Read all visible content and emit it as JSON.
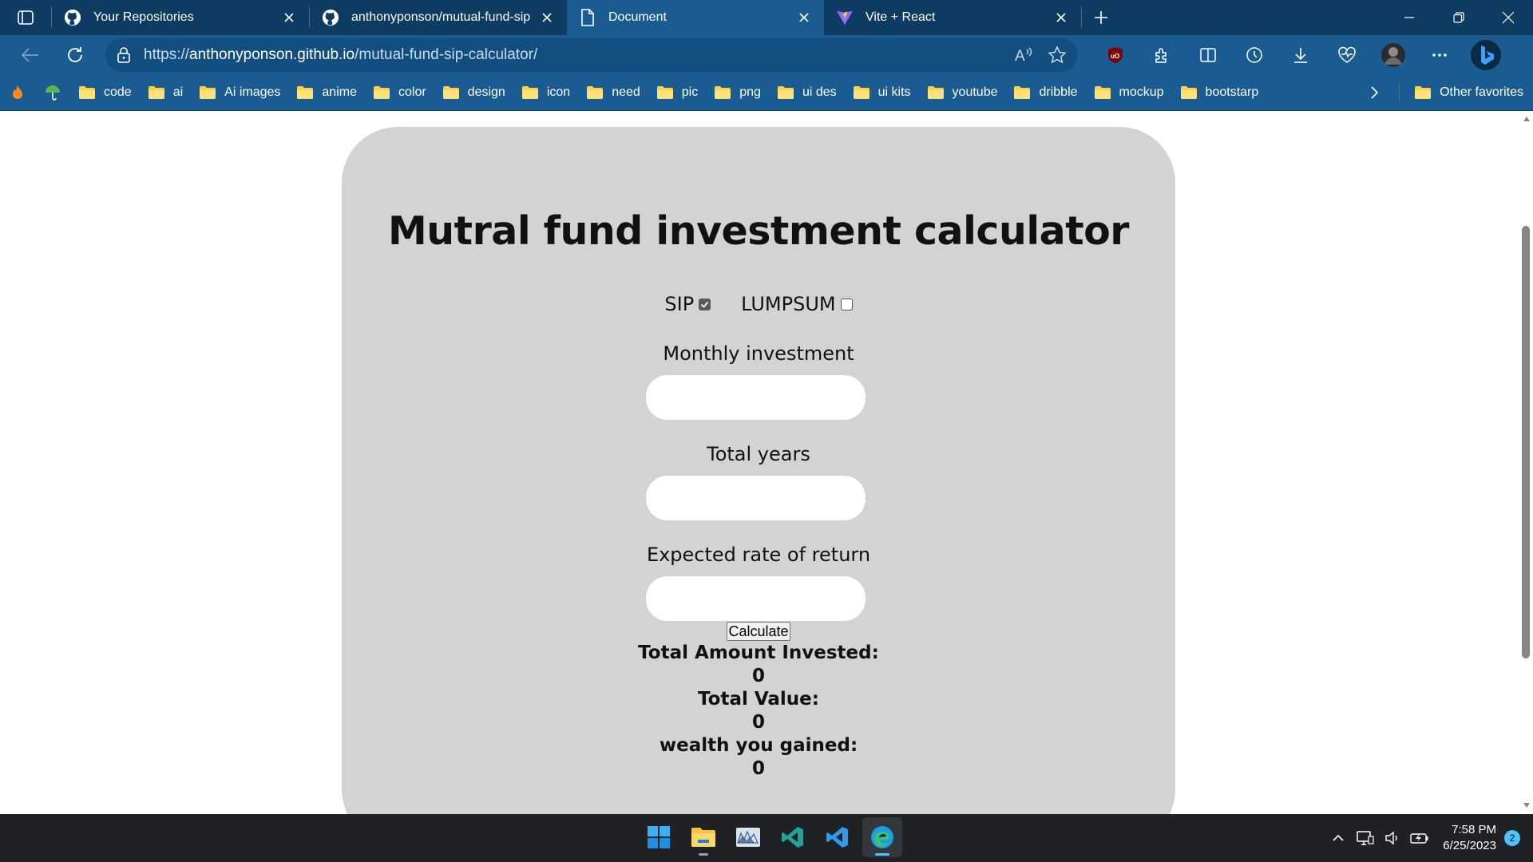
{
  "browser": {
    "tabs": [
      {
        "title": "Your Repositories",
        "icon": "github-icon"
      },
      {
        "title": "anthonyponson/mutual-fund-sip",
        "icon": "github-icon"
      },
      {
        "title": "Document",
        "icon": "document-icon"
      },
      {
        "title": "Vite + React",
        "icon": "vite-icon"
      }
    ],
    "active_tab": 2,
    "url_prefix": "https://",
    "url_domain": "anthonyponson.github.io",
    "url_path": "/mutual-fund-sip-calculator/",
    "bookmarks": [
      "code",
      "ai",
      "Ai images",
      "anime",
      "color",
      "design",
      "icon",
      "need",
      "pic",
      "png",
      "ui des",
      "ui kits",
      "youtube",
      "dribble",
      "mockup",
      "bootstarp"
    ],
    "other_favorites": "Other favorites"
  },
  "app": {
    "title": "Mutral fund investment calculator",
    "modes": {
      "sip_label": "SIP",
      "sip_checked": true,
      "lumpsum_label": "LUMPSUM",
      "lumpsum_checked": false
    },
    "fields": {
      "monthly_label": "Monthly investment",
      "monthly_value": "",
      "years_label": "Total years",
      "years_value": "",
      "rate_label": "Expected rate of return",
      "rate_value": ""
    },
    "calculate_label": "Calculate",
    "results": {
      "invested_label": "Total Amount Invested:",
      "invested_value": "0",
      "total_label": "Total Value:",
      "total_value": "0",
      "gained_label": "wealth you gained:",
      "gained_value": "0"
    }
  },
  "taskbar": {
    "time": "7:58 PM",
    "date": "6/25/2023",
    "notifications": "2"
  }
}
